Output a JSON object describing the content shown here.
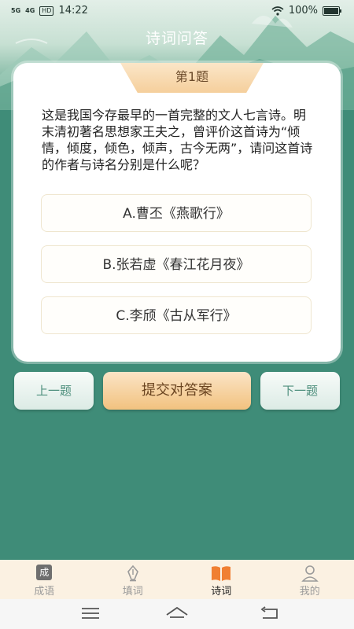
{
  "status_bar": {
    "signal_1": "5G",
    "signal_2": "4G",
    "hd": "HD",
    "time": "14:22",
    "battery": "100%",
    "battery_level": 1.0
  },
  "header": {
    "title": "诗词问答"
  },
  "question": {
    "number_label": "第1题",
    "text": "这是我国今存最早的一首完整的文人七言诗。明末清初著名思想家王夫之，曾评价这首诗为“倾情，倾度，倾色，倾声，古今无两”，请问这首诗的作者与诗名分别是什么呢？",
    "options": [
      {
        "label": "A.曹丕《燕歌行》"
      },
      {
        "label": "B.张若虚《春江花月夜》"
      },
      {
        "label": "C.李颀《古从军行》"
      }
    ]
  },
  "actions": {
    "prev_label": "上一题",
    "submit_label": "提交对答案",
    "next_label": "下一题"
  },
  "tabbar": {
    "items": [
      {
        "label": "成语",
        "icon": "idiom-icon",
        "icon_text": "成"
      },
      {
        "label": "填词",
        "icon": "fountain-pen-icon"
      },
      {
        "label": "诗词",
        "icon": "open-book-icon",
        "active": true
      },
      {
        "label": "我的",
        "icon": "user-icon"
      }
    ],
    "active_color": "#f07f32"
  },
  "colors": {
    "background": "#3f8c78",
    "accent": "#f2c27f",
    "secondary_text": "#4e8f7d"
  }
}
